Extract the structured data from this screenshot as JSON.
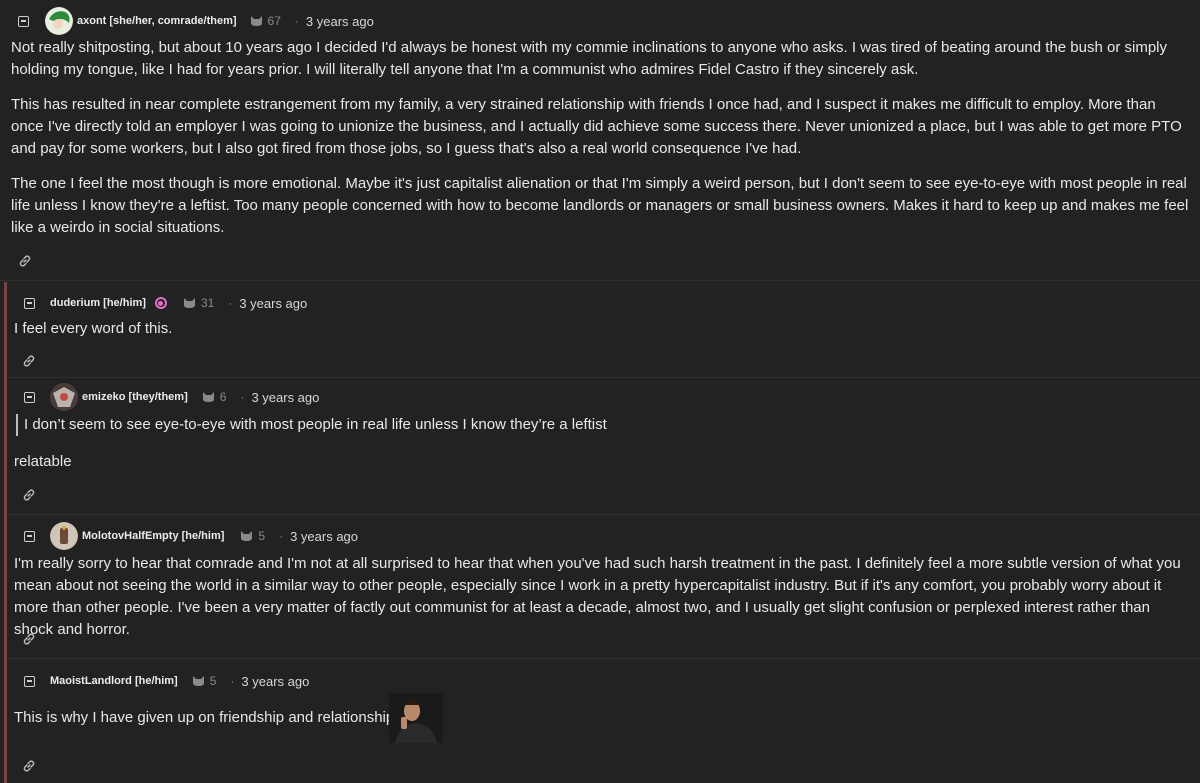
{
  "comments": [
    {
      "user": "axont [she/her, comrade/them]",
      "score": "67",
      "age": "3 years ago",
      "paragraphs": [
        "Not really shitposting, but about 10 years ago I decided I'd always be honest with my commie inclinations to anyone who asks. I was tired of beating around the bush or simply holding my tongue, like I had for years prior. I will literally tell anyone that I'm a communist who admires Fidel Castro if they sincerely ask.",
        "This has resulted in near complete estrangement from my family, a very strained relationship with friends I once had, and I suspect it makes me difficult to employ. More than once I've directly told an employer I was going to unionize the business, and I actually did achieve some success there. Never unionized a place, but I was able to get more PTO and pay for some workers, but I also got fired from those jobs, so I guess that's also a real world consequence I've had.",
        "The one I feel the most though is more emotional. Maybe it's just capitalist alienation or that I'm simply a weird person, but I don't seem to see eye-to-eye with most people in real life unless I know they're a leftist. Too many people concerned with how to become landlords or managers or small business owners. Makes it hard to keep up and makes me feel like a weirdo in social situations."
      ]
    },
    {
      "user": "duderium [he/him]",
      "score": "31",
      "age": "3 years ago",
      "paragraphs": [
        "I feel every word of this."
      ]
    },
    {
      "user": "emizeko [they/them]",
      "score": "6",
      "age": "3 years ago",
      "quote": "I don’t seem to see eye-to-eye with most people in real life unless I know they’re a leftist",
      "paragraphs": [
        "relatable"
      ]
    },
    {
      "user": "MolotovHalfEmpty [he/him]",
      "score": "5",
      "age": "3 years ago",
      "paragraphs": [
        "I'm really sorry to hear that comrade and I'm not at all surprised to hear that when you've had such harsh treatment in the past. I definitely feel a more subtle version of what you mean about not seeing the world in a similar way to other people, especially since I work in a pretty hypercapitalist industry. But if it's any comfort, you probably worry about it more than other people. I've been a very matter of factly out communist for at least a decade, almost two, and I usually get slight confusion or perplexed interest rather than shock and horror."
      ]
    },
    {
      "user": "MaoistLandlord [he/him]",
      "score": "5",
      "age": "3 years ago",
      "paragraphs": [
        "This is why I have given up on friendship and relationships"
      ]
    }
  ],
  "dot_separator": "·",
  "colors": {
    "background": "#222222",
    "thread_rail": "#7a4444",
    "mod_badge": "#e06fc8"
  }
}
